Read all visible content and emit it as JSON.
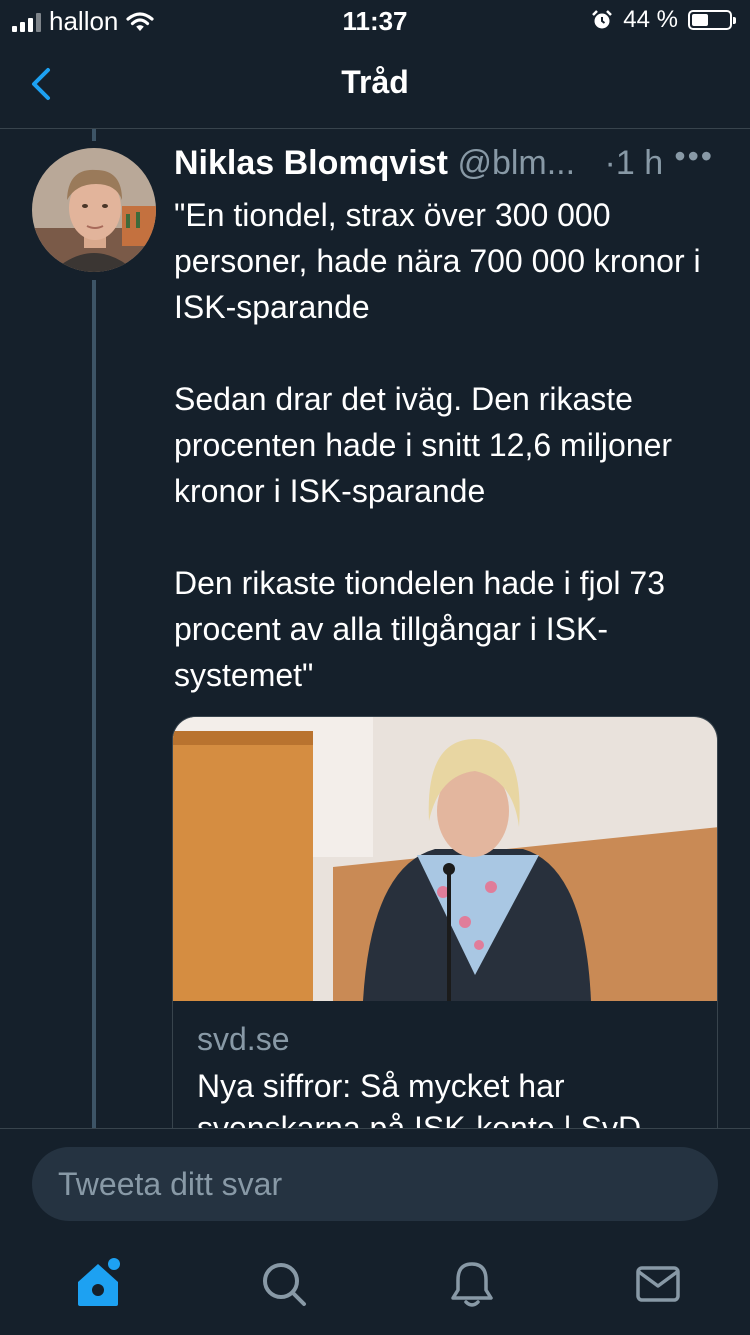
{
  "status_bar": {
    "carrier": "hallon",
    "time": "11:37",
    "battery": "44 %",
    "battery_level": 0.44
  },
  "nav": {
    "title": "Tråd"
  },
  "tweet": {
    "author_name": "Niklas Blomqvist",
    "author_handle": "@blm...",
    "dot": "·",
    "time": "1 h",
    "more": "•••",
    "paragraphs": [
      "\"En tiondel, strax över 300 000 personer, hade nära 700 000 kronor i ISK-sparande",
      "Sedan drar det iväg. Den rikaste procenten hade i snitt 12,6 miljoner kronor i ISK-sparande",
      "Den rikaste tiondelen hade i fjol 73 procent av alla tillgångar i ISK-systemet\""
    ]
  },
  "card": {
    "domain": "svd.se",
    "headline": "Nya siffror: Så mycket har svenskarna på ISK-konto | SvD"
  },
  "reply": {
    "placeholder": "Tweeta ditt svar"
  },
  "colors": {
    "background": "#15202b",
    "accent": "#1da1f2",
    "secondary_text": "#8899a6"
  },
  "tabs": [
    "home-icon",
    "search-icon",
    "notifications-icon",
    "messages-icon"
  ]
}
